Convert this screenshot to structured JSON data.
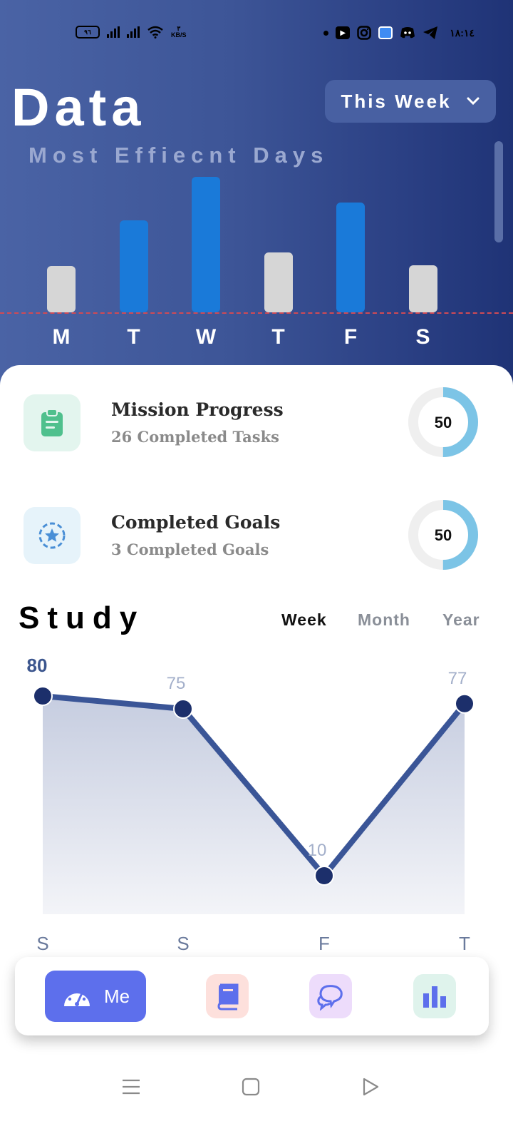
{
  "status_bar": {
    "battery": "٩٦",
    "net_speed": "KB/S",
    "net_speed_value": "٣",
    "time": "١٨:١٤",
    "icons": [
      "youtube-icon",
      "instagram-icon",
      "app-icon",
      "discord-icon",
      "telegram-icon"
    ]
  },
  "header": {
    "title": "Data",
    "subtitle": "Most Effiecnt Days",
    "range_selector": "This Week"
  },
  "chart_data": [
    {
      "type": "bar",
      "title": "Most Effiecnt Days",
      "categories": [
        "M",
        "T",
        "W",
        "T",
        "F",
        "S"
      ],
      "values": [
        34,
        68,
        100,
        44,
        81,
        35
      ],
      "highlighted": [
        false,
        true,
        true,
        false,
        true,
        false
      ],
      "colors": {
        "highlighted": "#1a7ad9",
        "normal": "#d6d6d6",
        "baseline": "#d04a55"
      },
      "ylim": [
        0,
        100
      ],
      "grid": false
    },
    {
      "type": "line",
      "title": "Study",
      "categories": [
        "S",
        "S",
        "F",
        "T"
      ],
      "values": [
        80,
        75,
        10,
        77
      ],
      "ylim": [
        0,
        100
      ],
      "colors": {
        "line": "#3a5597",
        "point": "#1c2f6b",
        "fill": "#c6cde0"
      },
      "grid": false
    }
  ],
  "stats": [
    {
      "title": "Mission Progress",
      "subtitle": "26 Completed Tasks",
      "value": "50",
      "progress": 0.5,
      "icon": "clipboard-icon",
      "icon_color": "#4fc08d",
      "icon_bg": "#e3f5ee"
    },
    {
      "title": "Completed Goals",
      "subtitle": "3 Completed Goals",
      "value": "50",
      "progress": 0.5,
      "icon": "star-badge-icon",
      "icon_color": "#4a8fd6",
      "icon_bg": "#e6f3fa"
    }
  ],
  "study": {
    "title": "Study",
    "tabs": [
      "Week",
      "Month",
      "Year"
    ],
    "active_tab": "Week"
  },
  "bottom_nav": {
    "me_label": "Me",
    "items": [
      "dashboard-icon",
      "book-icon",
      "chat-icon",
      "bar-chart-icon"
    ]
  }
}
